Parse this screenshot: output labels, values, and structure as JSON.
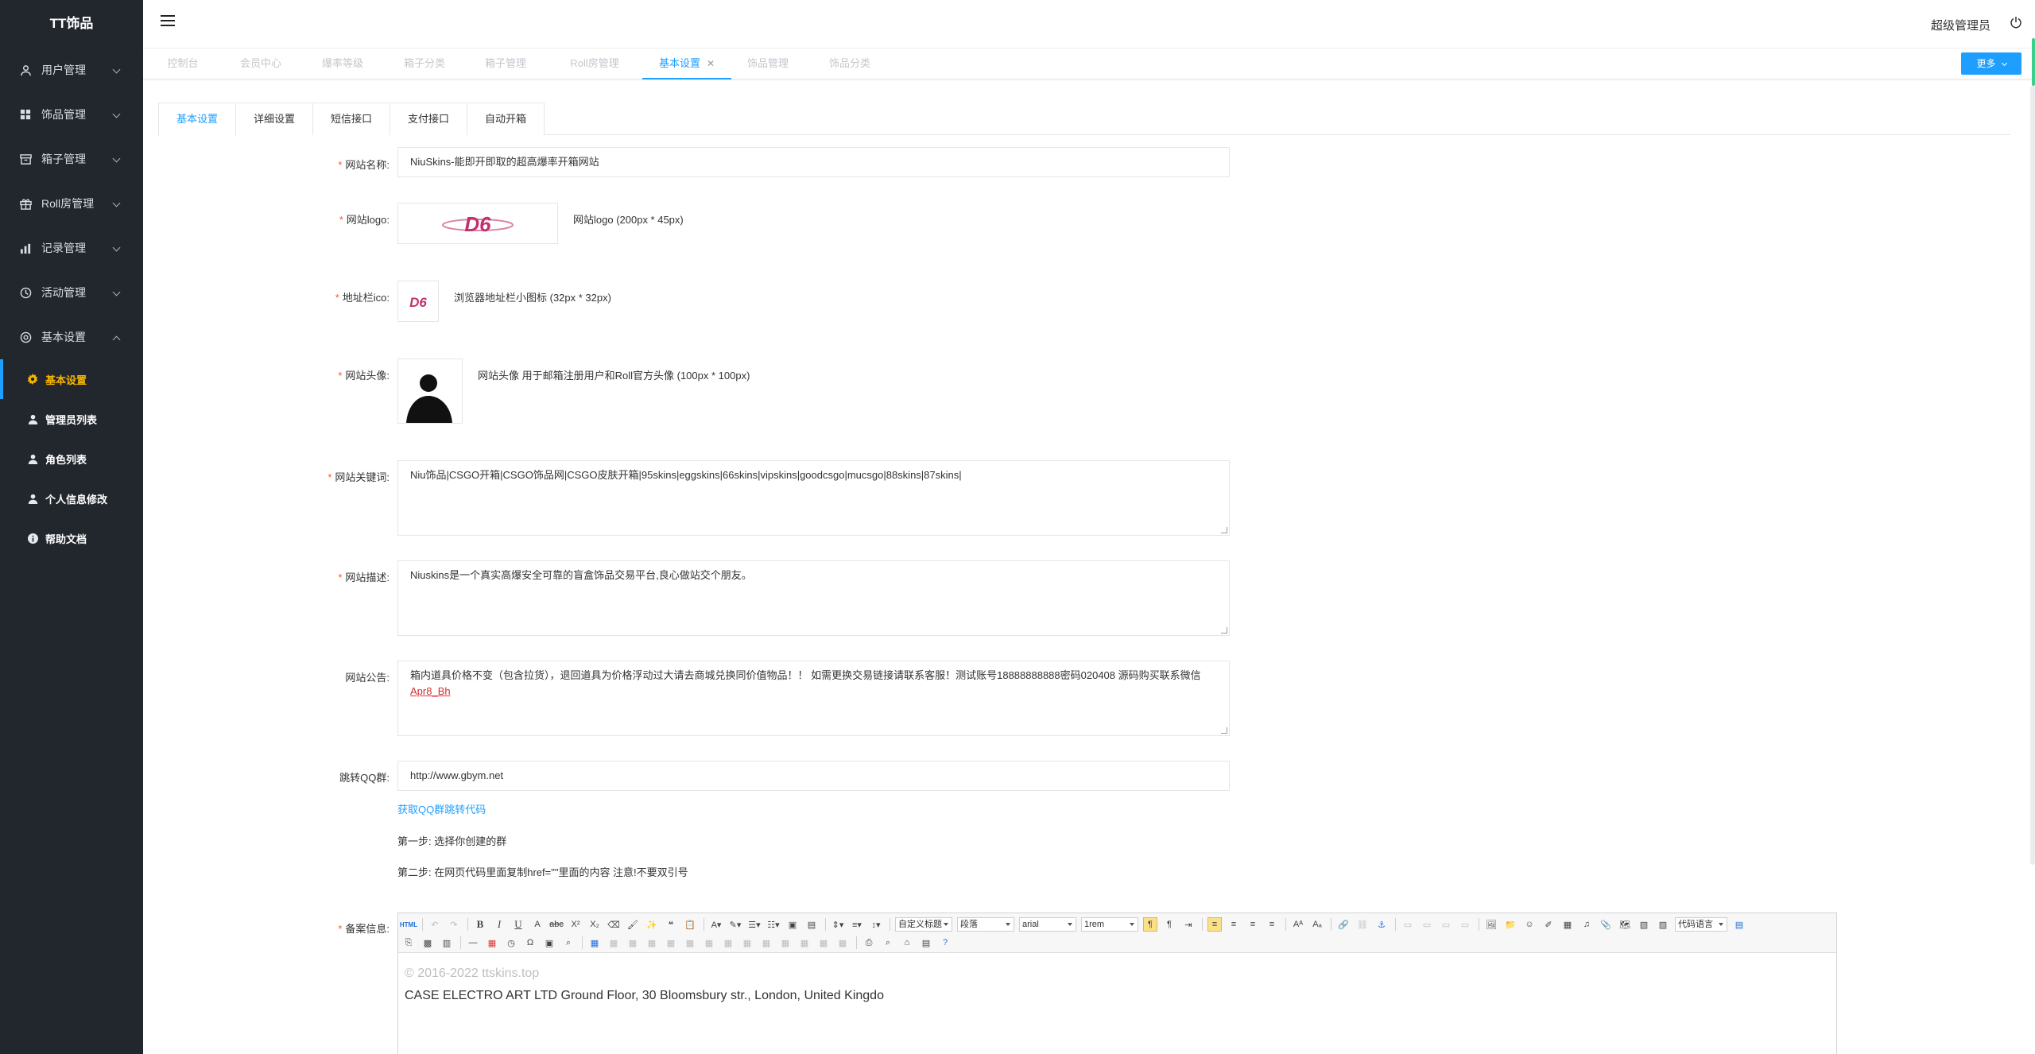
{
  "brand": "TT饰品",
  "sidebar": {
    "menus": [
      {
        "label": "用户管理",
        "icon": "user-icon"
      },
      {
        "label": "饰品管理",
        "icon": "grid-icon"
      },
      {
        "label": "箱子管理",
        "icon": "box-icon"
      },
      {
        "label": "Roll房管理",
        "icon": "gift-icon"
      },
      {
        "label": "记录管理",
        "icon": "chart-icon"
      },
      {
        "label": "活动管理",
        "icon": "clock-icon"
      },
      {
        "label": "基本设置",
        "icon": "settings-icon"
      }
    ],
    "submenu": [
      {
        "label": "基本设置",
        "icon": "gear-icon",
        "active": true
      },
      {
        "label": "管理员列表",
        "icon": "user-icon"
      },
      {
        "label": "角色列表",
        "icon": "user-icon"
      },
      {
        "label": "个人信息修改",
        "icon": "user-icon"
      },
      {
        "label": "帮助文档",
        "icon": "info-icon"
      }
    ]
  },
  "header": {
    "admin_name": "超级管理员"
  },
  "page_tabs": [
    {
      "label": "控制台"
    },
    {
      "label": "会员中心"
    },
    {
      "label": "爆率等级"
    },
    {
      "label": "箱子分类"
    },
    {
      "label": "箱子管理"
    },
    {
      "label": "Roll房管理"
    },
    {
      "label": "基本设置",
      "active": true
    },
    {
      "label": "饰品管理"
    },
    {
      "label": "饰品分类"
    }
  ],
  "more_label": "更多",
  "form_tabs": [
    "基本设置",
    "详细设置",
    "短信接口",
    "支付接口",
    "自动开箱"
  ],
  "form": {
    "site_name": {
      "label": "网站名称:",
      "value": "NiuSkins-能即开即取的超高爆率开箱网站"
    },
    "site_logo": {
      "label": "网站logo:",
      "hint": "网站logo (200px * 45px)",
      "logo_text": "D6"
    },
    "favicon": {
      "label": "地址栏ico:",
      "hint": "浏览器地址栏小图标 (32px * 32px)",
      "logo_text": "D6"
    },
    "avatar": {
      "label": "网站头像:",
      "hint": "网站头像 用于邮箱注册用户和Roll官方头像 (100px * 100px)"
    },
    "keywords": {
      "label": "网站关键词:",
      "value": "Niu饰品|CSGO开箱|CSGO饰品网|CSGO皮肤开箱|95skins|eggskins|66skins|vipskins|goodcsgo|mucsgo|88skins|87skins|"
    },
    "description": {
      "label": "网站描述:",
      "value": "Niuskins是一个真实高爆安全可靠的盲盒饰品交易平台,良心做站交个朋友。"
    },
    "notice": {
      "label": "网站公告:",
      "value_a": "箱内道具价格不变（包含拉货），退回道具为价格浮动过大请去商城兑换同价值物品！！ 如需更换交易链接请联系客服！测试账号18888888888密码020408 源码购买联系微信",
      "value_b": "Apr8_Bh"
    },
    "qq": {
      "label": "跳转QQ群:",
      "value": "http://www.gbym.net",
      "link": "获取QQ群跳转代码",
      "step1": "第一步: 选择你创建的群",
      "step2": "第二步: 在网页代码里面复制href=\"\"里面的内容 注意!不要双引号"
    },
    "icp": {
      "label": "备案信息:",
      "toolbar": {
        "select_heading": "自定义标题",
        "select_para": "段落",
        "select_font": "arial",
        "select_size": "1rem",
        "select_code": "代码语言"
      },
      "line1": "© 2016-2022 ttskins.top",
      "line2": "CASE ELECTRO ART LTD Ground Floor, 30 Bloomsbury str., London, United Kingdo"
    }
  },
  "colors": {
    "sidebar_bg": "#22272e",
    "accent": "#1e9fff",
    "active_sub": "#f7b500",
    "required": "#ff5722",
    "logo_magenta": "#c2306f"
  }
}
